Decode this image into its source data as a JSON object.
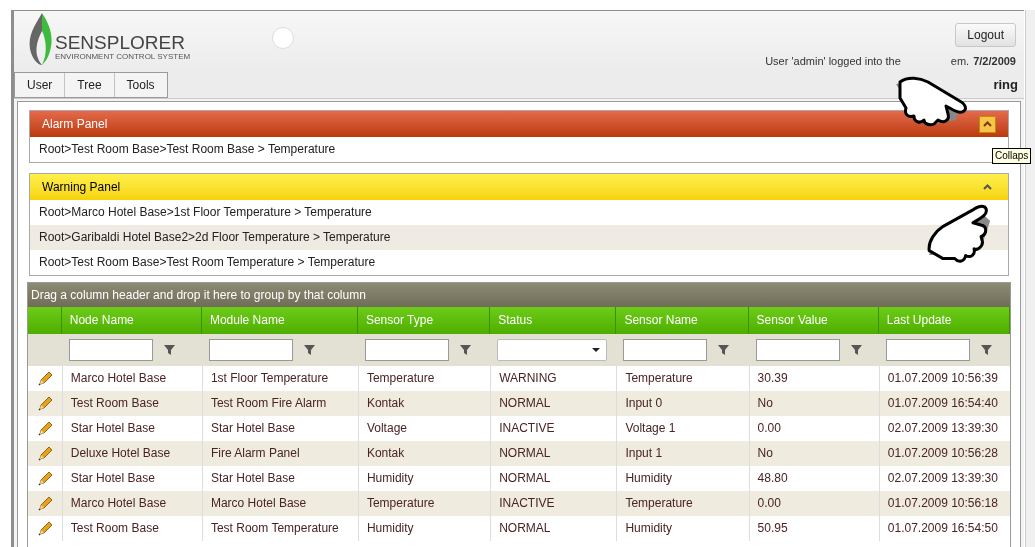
{
  "header": {
    "logo_title": "SENSPLORER",
    "logo_subtitle": "ENVIRONMENT CONTROL SYSTEM",
    "logout": "Logout",
    "login_text": "User 'admin' logged into the",
    "login_text_tail": "em.",
    "login_date": "7/2/2009"
  },
  "menu": {
    "items": [
      {
        "label": "User"
      },
      {
        "label": "Tree"
      },
      {
        "label": "Tools"
      }
    ],
    "page_title": "ring"
  },
  "alarm_panel": {
    "title": "Alarm Panel",
    "expanded": true,
    "rows": [
      "Root>Test Room Base>Test Room Base > Temperature"
    ],
    "tooltip": "Collaps"
  },
  "warning_panel": {
    "title": "Warning Panel",
    "expanded": true,
    "rows": [
      "Root>Marco Hotel Base>1st Floor Temperature > Temperature",
      "Root>Garibaldi Hotel Base2>2d Floor Temperature > Temperature",
      "Root>Test Room Base>Test Room Temperature > Temperature"
    ]
  },
  "grid": {
    "group_hint": "Drag a column header and drop it here to group by that column",
    "columns": [
      {
        "label": "Node Name",
        "kind": "text"
      },
      {
        "label": "Module Name",
        "kind": "text"
      },
      {
        "label": "Sensor Type",
        "kind": "text"
      },
      {
        "label": "Status",
        "kind": "dropdown"
      },
      {
        "label": "Sensor Name",
        "kind": "text"
      },
      {
        "label": "Sensor Value",
        "kind": "text"
      },
      {
        "label": "Last Update",
        "kind": "text"
      }
    ],
    "rows": [
      [
        "Marco Hotel Base",
        "1st Floor Temperature",
        "Temperature",
        "WARNING",
        "Temperature",
        "30.39",
        "01.07.2009 10:56:39"
      ],
      [
        "Test Room Base",
        "Test Room Fire Alarm",
        "Kontak",
        "NORMAL",
        "Input 0",
        "No",
        "01.07.2009 16:54:40"
      ],
      [
        "Star Hotel Base",
        "Star Hotel Base",
        "Voltage",
        "INACTIVE",
        "Voltage 1",
        "0.00",
        "02.07.2009 13:39:30"
      ],
      [
        "Deluxe Hotel Base",
        "Fire Alarm Panel",
        "Kontak",
        "NORMAL",
        "Input 1",
        "No",
        "01.07.2009 10:56:28"
      ],
      [
        "Star Hotel Base",
        "Star Hotel Base",
        "Humidity",
        "NORMAL",
        "Humidity",
        "48.80",
        "02.07.2009 13:39:30"
      ],
      [
        "Marco Hotel Base",
        "Marco Hotel Base",
        "Temperature",
        "INACTIVE",
        "Temperature",
        "0.00",
        "01.07.2009 10:56:18"
      ],
      [
        "Test Room Base",
        "Test Room Temperature",
        "Humidity",
        "NORMAL",
        "Humidity",
        "50.95",
        "01.07.2009 16:54:50"
      ]
    ]
  }
}
